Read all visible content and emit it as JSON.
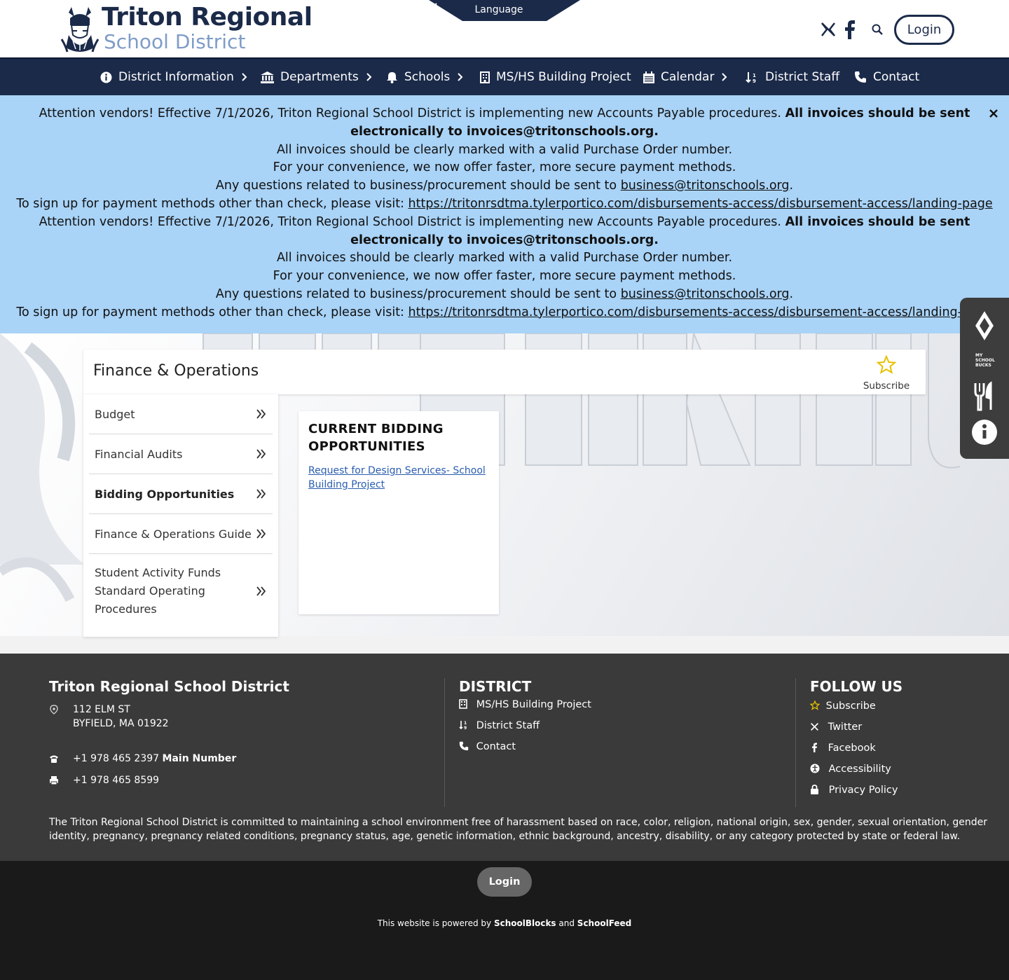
{
  "header": {
    "logo_title": "Triton Regional",
    "logo_subtitle": "School District",
    "language_label": "Language",
    "login_label": "Login"
  },
  "nav": {
    "items": [
      {
        "label": "District Information",
        "icon": "info-icon",
        "has_chevron": true
      },
      {
        "label": "Departments",
        "icon": "building-columns-icon",
        "has_chevron": true
      },
      {
        "label": "Schools",
        "icon": "bell-icon",
        "has_chevron": true
      },
      {
        "label": "MS/HS Building Project",
        "icon": "building-icon",
        "has_chevron": false
      },
      {
        "label": "Calendar",
        "icon": "calendar-icon",
        "has_chevron": true
      },
      {
        "label": "District Staff",
        "icon": "sort-icon",
        "has_chevron": false
      },
      {
        "label": "Contact",
        "icon": "phone-icon",
        "has_chevron": false
      }
    ]
  },
  "alert": {
    "line1_a": "Attention vendors! Effective 7/1/2026, Triton Regional School District is implementing new Accounts Payable procedures. ",
    "line1_b": "All invoices should be sent electronically to invoices@tritonschools.org.",
    "line2": "All invoices should be clearly marked with a valid Purchase Order number.",
    "line3": "For your convenience, we now offer faster, more secure payment methods.",
    "line4_a": "Any questions related to business/procurement should be sent to ",
    "line4_link": "business@tritonschools.org",
    "line4_b": ".",
    "line5_a": "To sign up for payment methods other than check, please visit: ",
    "line5_link": "https://tritonrsdtma.tylerportico.com/disbursements-access/disbursement-access/landing-page",
    "close_icon": "close-icon"
  },
  "page": {
    "title": "Finance & Operations",
    "subscribe_label": "Subscribe"
  },
  "sidebar": {
    "items": [
      {
        "label": "Budget",
        "active": false
      },
      {
        "label": "Financial Audits",
        "active": false
      },
      {
        "label": "Bidding Opportunities",
        "active": true
      },
      {
        "label": "Finance & Operations Guide",
        "active": false
      },
      {
        "label": "Student Activity Funds Standard Operating Procedures",
        "active": false
      }
    ]
  },
  "card": {
    "title": "CURRENT BIDDING OPPORTUNITIES",
    "link": "Request for Design Services- School Building Project"
  },
  "dock": {
    "items": [
      "app-icon",
      "my-school-bucks-icon",
      "fork-knife-icon",
      "info-circle-icon"
    ]
  },
  "footer": {
    "school_name": "Triton Regional School District",
    "address_line1": "112 ELM ST",
    "address_line2": "BYFIELD, MA 01922",
    "phone": "+1 978 465 2397",
    "phone_label": "Main Number",
    "fax": "+1 978 465 8599",
    "district_heading": "DISTRICT",
    "district_links": [
      "MS/HS Building Project",
      "District Staff",
      "Contact"
    ],
    "follow_heading": "FOLLOW US",
    "follow_links": [
      "Subscribe",
      "Twitter",
      "Facebook",
      "Accessibility",
      "Privacy Policy"
    ],
    "notice": "The Triton Regional School District is committed to maintaining a school environment free of harassment based on race, color, religion, national origin, sex, gender, sexual orientation, gender identity, pregnancy, pregnancy related conditions, pregnancy status, age, genetic information, ethnic background, ancestry, disability, or any category protected by state or federal law."
  },
  "bottom": {
    "login_label": "Login",
    "powered_prefix": "This website is powered by ",
    "powered_brand1": "SchoolBlocks",
    "powered_and": " and ",
    "powered_brand2": "SchoolFeed"
  },
  "colors": {
    "navy": "#1b2a49",
    "alert_bg": "#a9d3f7",
    "footer_bg": "#3a3a3a",
    "bottom_bg": "#1a1a1a",
    "link": "#2a5db0",
    "star": "#e6c100"
  }
}
